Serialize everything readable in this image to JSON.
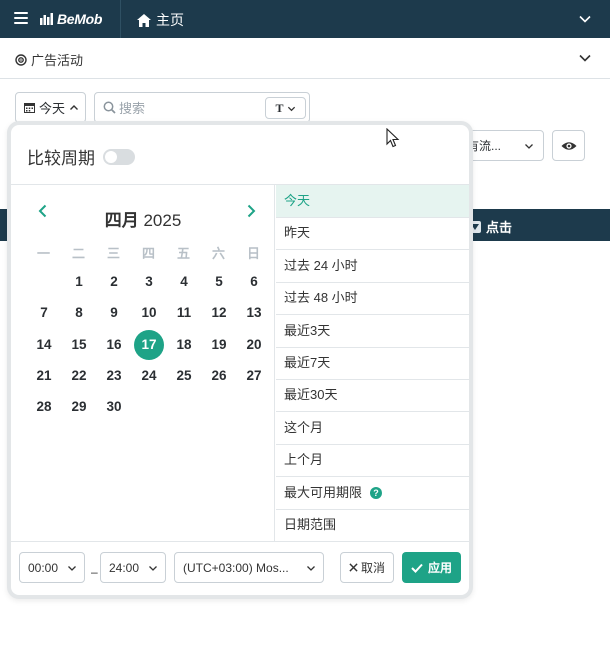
{
  "topbar": {
    "brand": "BeMob",
    "home_label": "主页"
  },
  "section": {
    "title": "广告活动"
  },
  "filters": {
    "date_button_label": "今天",
    "search_placeholder": "搜索",
    "search_type_label": "T",
    "traffic_label": "有流..."
  },
  "table": {
    "clicks_header": "点击"
  },
  "popup": {
    "compare_label": "比较周期",
    "compare_enabled": false,
    "calendar": {
      "month": "四月",
      "year": "2025",
      "weekdays": [
        "一",
        "二",
        "三",
        "四",
        "五",
        "六",
        "日"
      ],
      "days": [
        "1",
        "2",
        "3",
        "4",
        "5",
        "6",
        "7",
        "8",
        "9",
        "10",
        "11",
        "12",
        "13",
        "14",
        "15",
        "16",
        "17",
        "18",
        "19",
        "20",
        "21",
        "22",
        "23",
        "24",
        "25",
        "26",
        "27",
        "28",
        "29",
        "30"
      ],
      "today": "17"
    },
    "presets": [
      {
        "label": "今天",
        "active": true
      },
      {
        "label": "昨天"
      },
      {
        "label": "过去 24 小时"
      },
      {
        "label": "过去 48 小时"
      },
      {
        "label": "最近3天"
      },
      {
        "label": "最近7天"
      },
      {
        "label": "最近30天"
      },
      {
        "label": "这个月"
      },
      {
        "label": "上个月"
      },
      {
        "label": "最大可用期限",
        "help": "?"
      },
      {
        "label": "日期范围"
      }
    ],
    "footer": {
      "time_from": "00:00",
      "time_separator": "–",
      "time_to": "24:00",
      "timezone": "(UTC+03:00) Mos...",
      "cancel_label": "取消",
      "apply_label": "应用"
    }
  },
  "colors": {
    "navbar": "#1d3a4c",
    "accent": "#1ea387"
  }
}
